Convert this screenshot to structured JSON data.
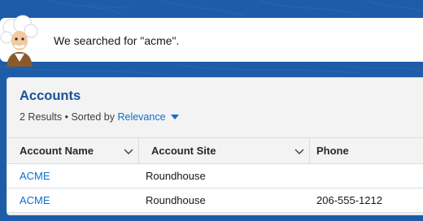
{
  "assistant": {
    "message": "We searched for \"acme\"."
  },
  "results": {
    "title": "Accounts",
    "count_text": "2 Results",
    "separator": "•",
    "sorted_by_label": "Sorted by",
    "sort_value": "Relevance",
    "columns": [
      {
        "label": "Account Name"
      },
      {
        "label": "Account Site"
      },
      {
        "label": "Phone"
      }
    ],
    "rows": [
      {
        "name": "ACME",
        "site": "Roundhouse",
        "phone": ""
      },
      {
        "name": "ACME",
        "site": "Roundhouse",
        "phone": "206-555-1212"
      }
    ]
  },
  "colors": {
    "background": "#1f5ca8",
    "title": "#1b5297",
    "link": "#0b6fd0"
  },
  "icons": {
    "mascot": "einstein-mascot-icon",
    "sort": "caret-down-icon",
    "column_menu": "chevron-down-icon"
  }
}
